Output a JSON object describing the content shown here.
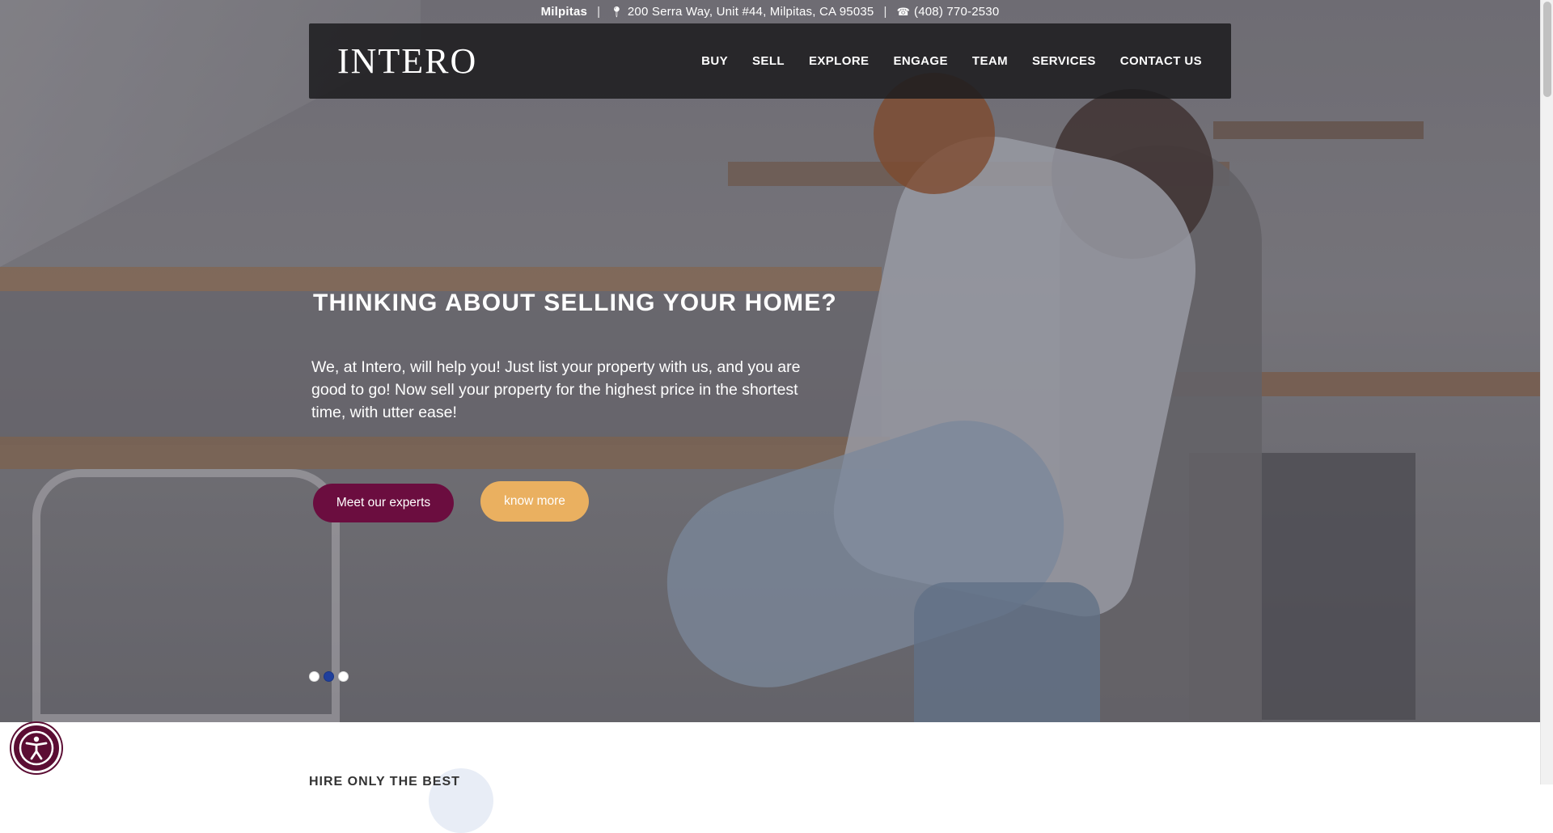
{
  "topbar": {
    "city": "Milpitas",
    "address_icon": "map-marker-icon",
    "address": "200 Serra Way, Unit #44, Milpitas, CA 95035",
    "phone_icon": "phone-icon",
    "phone": "(408) 770-2530",
    "separator": "|"
  },
  "navbar": {
    "logo": "INTERO",
    "items": [
      {
        "label": "BUY"
      },
      {
        "label": "SELL"
      },
      {
        "label": "EXPLORE"
      },
      {
        "label": "ENGAGE"
      },
      {
        "label": "TEAM"
      },
      {
        "label": "SERVICES"
      },
      {
        "label": "CONTACT US"
      }
    ]
  },
  "hero": {
    "title": "THINKING ABOUT SELLING YOUR HOME?",
    "description": "We, at Intero, will help you! Just list your property with us, and you are good to go! Now sell your property for the highest price in the shortest time, with utter ease!",
    "primary_button": "Meet our experts",
    "secondary_button": "know more",
    "slides": 3,
    "active_slide": 2
  },
  "section": {
    "heading": "HIRE ONLY THE BEST"
  },
  "accessibility_button": {
    "icon": "accessibility-icon"
  },
  "colors": {
    "primary": "#6b0d3f",
    "secondary": "#eab060",
    "active_dot": "#1f3f9c",
    "navbar_bg": "#1c1c1e"
  }
}
